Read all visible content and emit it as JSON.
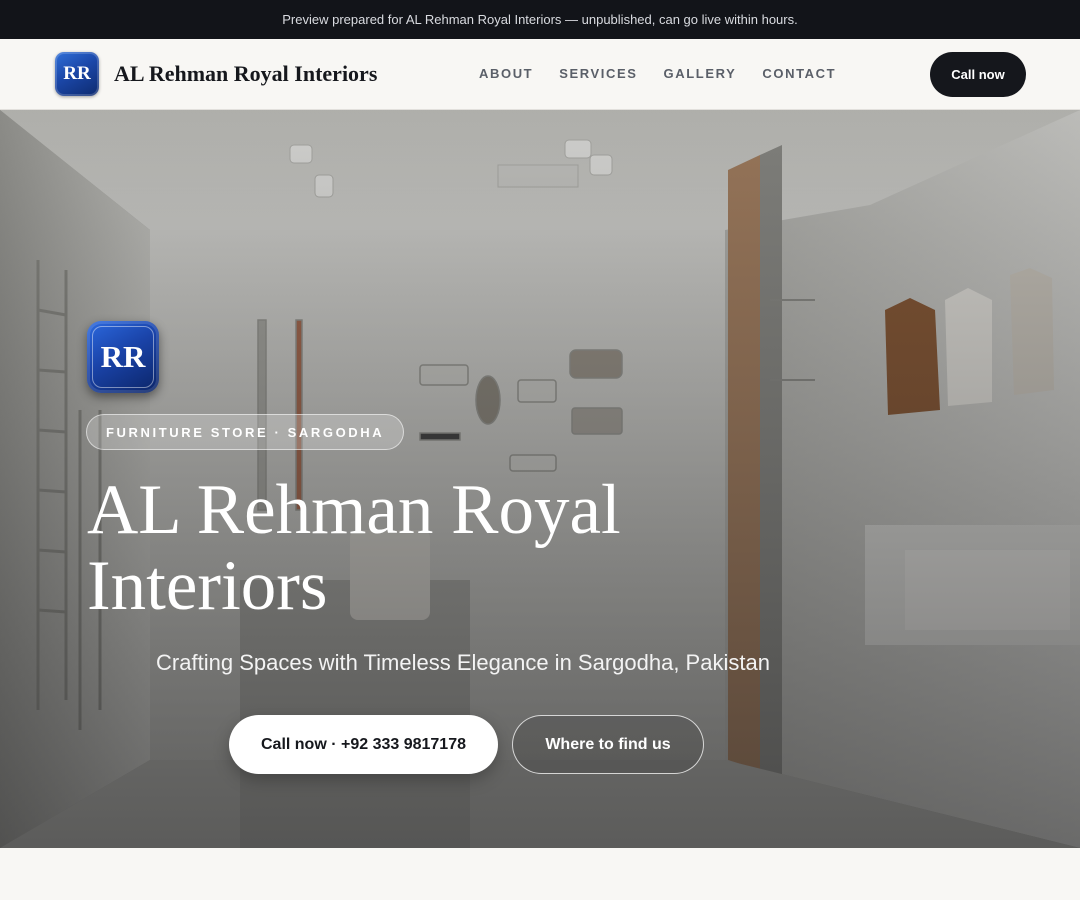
{
  "preview_bar": {
    "text": "Preview prepared for AL Rehman Royal Interiors — unpublished, can go live within hours."
  },
  "header": {
    "logo_text": "RR",
    "brand_name": "AL Rehman Royal Interiors",
    "nav": [
      "ABOUT",
      "SERVICES",
      "GALLERY",
      "CONTACT"
    ],
    "call_label": "Call now"
  },
  "hero": {
    "logo_text": "RR",
    "category": "FURNITURE STORE · SARGODHA",
    "title_line1": "AL Rehman Royal",
    "title_line2": "Interiors",
    "tagline": "Crafting Spaces with Timeless Elegance in Sargodha, Pakistan",
    "primary_cta": "Call now · +92 333 9817178",
    "secondary_cta": "Where to find us"
  },
  "colors": {
    "preview_bar_bg": "#121419",
    "header_bg": "#f8f7f4",
    "call_button_bg": "#15171c",
    "logo_blue": "#1b47a8"
  }
}
